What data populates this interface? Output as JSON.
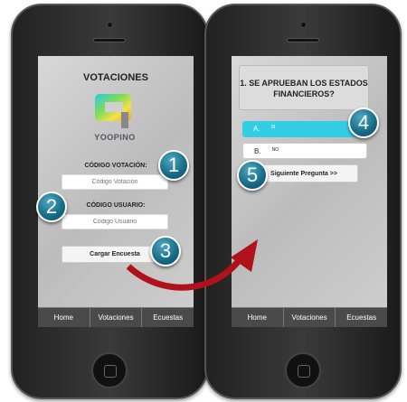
{
  "left_screen": {
    "title": "VOTACIONES",
    "logo_text": "YOOPINO",
    "code_vote_label": "CÓDIGO VOTACIÓN:",
    "code_vote_placeholder": "Código Votación",
    "code_user_label": "CÓDIGO USUARIO:",
    "code_user_placeholder": "Código Usuario",
    "load_button": "Cargar Encuesta"
  },
  "right_screen": {
    "question": "1. SE APRUEBAN LOS ESTADOS FINANCIEROS?",
    "options": [
      {
        "letter": "A.",
        "text": "SI",
        "selected": true
      },
      {
        "letter": "B.",
        "text": "NO",
        "selected": false
      }
    ],
    "next_button": "Siguiente Pregunta >>"
  },
  "tabs": [
    "Home",
    "Votaciones",
    "Ecuestas"
  ],
  "badges": [
    "1",
    "2",
    "3",
    "4",
    "5"
  ],
  "colors": {
    "accent": "#33cde6",
    "badge": "#166a86",
    "arrow": "#b0121b"
  }
}
